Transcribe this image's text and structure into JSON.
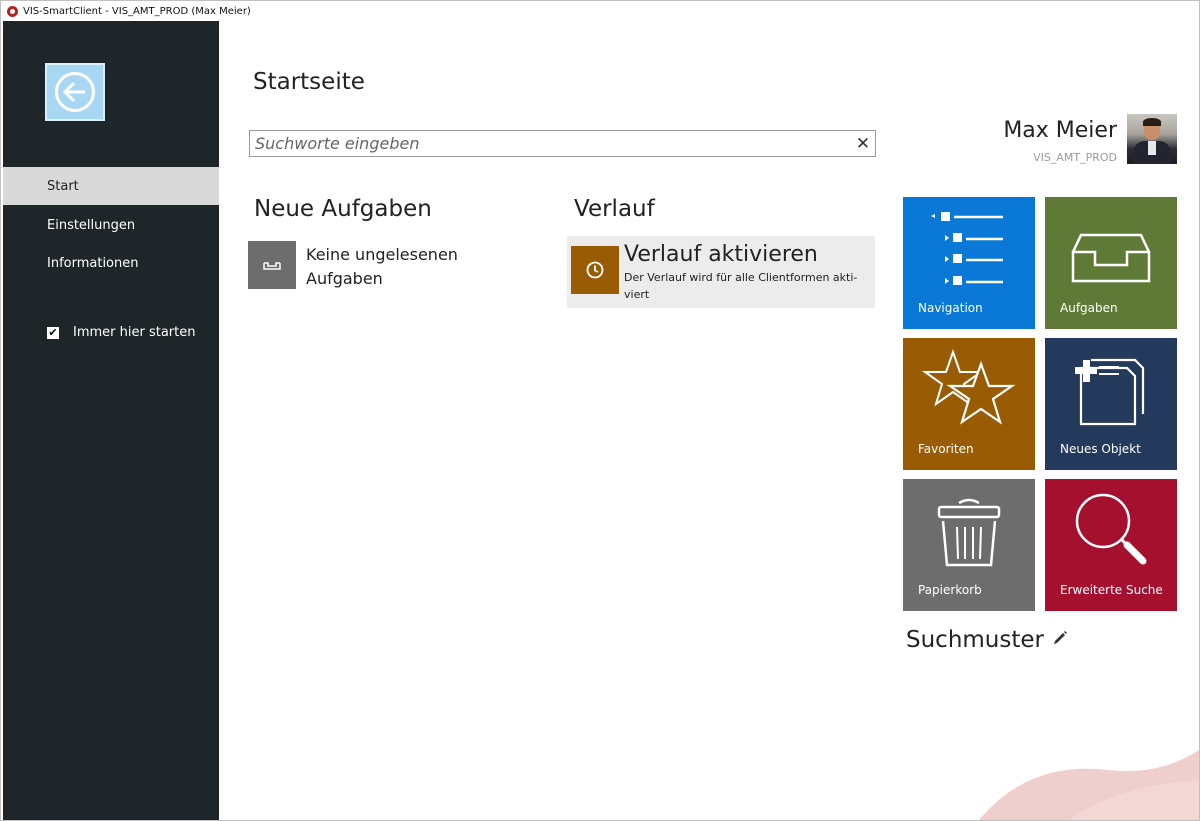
{
  "window": {
    "title": "VIS-SmartClient - VIS_AMT_PROD (Max Meier)"
  },
  "sidebar": {
    "items": [
      {
        "label": "Start",
        "active": true
      },
      {
        "label": "Einstellungen",
        "active": false
      },
      {
        "label": "Informationen",
        "active": false
      }
    ],
    "always_start": {
      "label": "Immer hier starten",
      "checked": true
    }
  },
  "main": {
    "title": "Startseite",
    "search": {
      "placeholder": "Suchworte eingeben",
      "value": ""
    },
    "tasks": {
      "title": "Neue Aufgaben",
      "empty_text": "Keine ungelesenen Aufgaben"
    },
    "history": {
      "title": "Verlauf",
      "action_title": "Verlauf aktivieren",
      "action_subtitle": "Der Verlauf wird für alle Clientformen akti-viert"
    }
  },
  "user": {
    "name": "Max Meier",
    "environment": "VIS_AMT_PROD"
  },
  "tiles": [
    {
      "label": "Navigation",
      "color": "#0a78d7",
      "icon": "navigation-tree-icon"
    },
    {
      "label": "Aufgaben",
      "color": "#5f7a36",
      "icon": "inbox-tray-icon"
    },
    {
      "label": "Favoriten",
      "color": "#9a5b05",
      "icon": "star-icon"
    },
    {
      "label": "Neues Objekt",
      "color": "#233a5c",
      "icon": "new-document-icon"
    },
    {
      "label": "Papierkorb",
      "color": "#6d6d6d",
      "icon": "trash-icon"
    },
    {
      "label": "Erweiterte Suche",
      "color": "#a5102f",
      "icon": "magnifier-icon"
    }
  ],
  "search_patterns": {
    "label": "Suchmuster",
    "icon": "pencil-icon"
  },
  "colors": {
    "sidebar": "#1f262a",
    "accent_back": "#a8d7f3",
    "active_nav": "#d9d9d9"
  }
}
